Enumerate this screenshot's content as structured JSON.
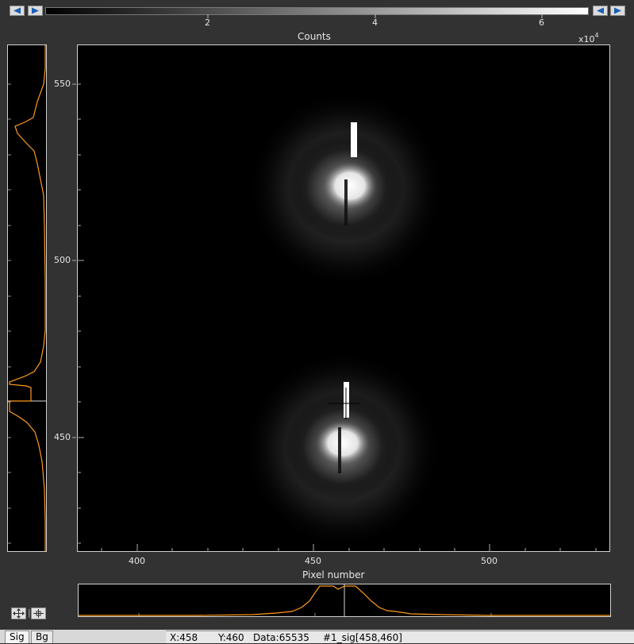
{
  "colorbar": {
    "ticks": [
      "2",
      "4",
      "6"
    ],
    "title": "Counts",
    "exponent_base": "x10",
    "exponent_power": "4",
    "nav_buttons": [
      "left-arrow-icon",
      "right-arrow-icon"
    ]
  },
  "main_image": {
    "y_ticks": [
      "550",
      "500",
      "450"
    ],
    "x_ticks": [
      "400",
      "450",
      "500"
    ],
    "x_label": "Pixel number",
    "cursor": {
      "x": 458,
      "y": 460
    }
  },
  "side_profile": {
    "line_color": "#ff9a1f"
  },
  "bottom_profile": {
    "line_color": "#ff9a1f"
  },
  "tabs": [
    {
      "label": "Sig",
      "active": true
    },
    {
      "label": "Bg",
      "active": false
    }
  ],
  "status_bar": {
    "x": "X:458",
    "y": "Y:460",
    "data": "Data:65535",
    "ref": "#1_sig[458,460]"
  },
  "tools": [
    "pan-icon",
    "zoom-icon"
  ]
}
